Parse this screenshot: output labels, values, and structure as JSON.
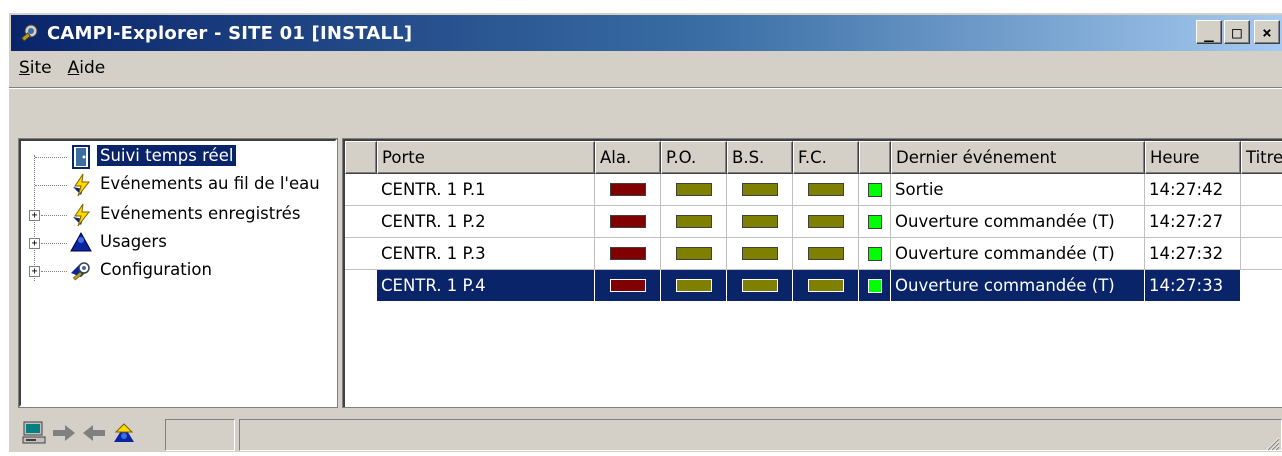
{
  "window": {
    "title": "CAMPI-Explorer - SITE 01 [INSTALL]",
    "buttons": {
      "minimize": "_",
      "maximize": "□",
      "close": "×"
    }
  },
  "menu": [
    {
      "label_underlined": "S",
      "label_rest": "ite"
    },
    {
      "label_underlined": "A",
      "label_rest": "ide"
    }
  ],
  "tree": {
    "items": [
      {
        "label": "Suivi temps réel",
        "icon": "door-icon",
        "expander": "",
        "selected": true
      },
      {
        "label": "Evénements au fil de l'eau",
        "icon": "lightning-icon",
        "expander": ""
      },
      {
        "label": "Evénements enregistrés",
        "icon": "lightning-icon",
        "expander": "+"
      },
      {
        "label": "Usagers",
        "icon": "users-icon",
        "expander": "+"
      },
      {
        "label": "Configuration",
        "icon": "config-icon",
        "expander": "+"
      }
    ]
  },
  "table": {
    "columns": [
      "",
      "Porte",
      "Ala.",
      "P.O.",
      "B.S.",
      "F.C.",
      "",
      "Dernier événement",
      "Heure",
      "Titre"
    ],
    "rows": [
      {
        "porte": "CENTR. 1 P.1",
        "evenement": "Sortie",
        "heure": "14:27:42"
      },
      {
        "porte": "CENTR. 1 P.2",
        "evenement": "Ouverture commandée (T)",
        "heure": "14:27:27"
      },
      {
        "porte": "CENTR. 1 P.3",
        "evenement": "Ouverture commandée (T)",
        "heure": "14:27:32"
      },
      {
        "porte": "CENTR. 1 P.4",
        "evenement": "Ouverture commandée (T)",
        "heure": "14:27:33",
        "selected": true
      }
    ],
    "colors": {
      "alarm": "#800000",
      "olive": "#808000",
      "status_green": "#00ff00"
    }
  },
  "statusbar": {
    "icons": [
      "computer-icon",
      "arrow-right-icon",
      "arrow-left-icon",
      "user-icon"
    ]
  }
}
